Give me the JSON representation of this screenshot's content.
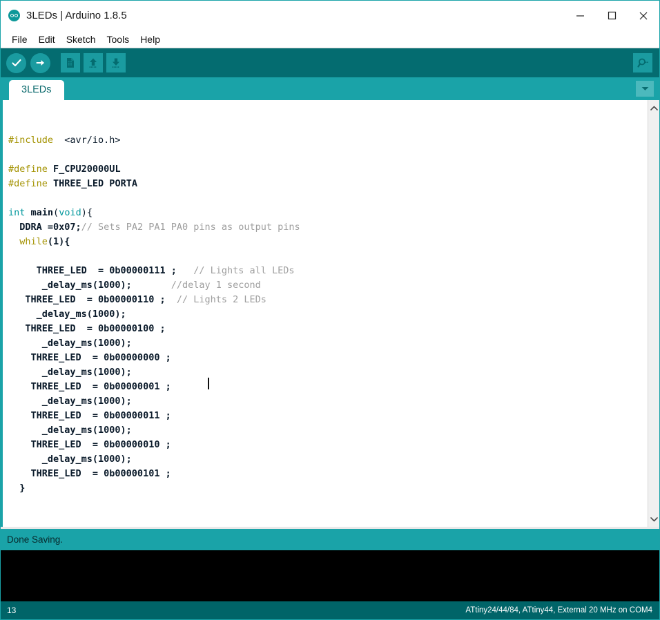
{
  "window": {
    "title": "3LEDs | Arduino 1.8.5",
    "logo_icon": "arduino-logo-icon",
    "controls": [
      {
        "name": "minimize-button",
        "icon": "minimize-icon",
        "label": "—"
      },
      {
        "name": "maximize-button",
        "icon": "maximize-icon",
        "label": "□"
      },
      {
        "name": "close-button",
        "icon": "close-icon",
        "label": "✕"
      }
    ]
  },
  "menubar": {
    "items": [
      {
        "label": "File"
      },
      {
        "label": "Edit"
      },
      {
        "label": "Sketch"
      },
      {
        "label": "Tools"
      },
      {
        "label": "Help"
      }
    ]
  },
  "toolbar": {
    "verify_label": "Verify",
    "upload_label": "Upload",
    "new_label": "New",
    "open_label": "Open",
    "save_label": "Save",
    "serial_monitor_label": "Serial Monitor"
  },
  "tabs": {
    "items": [
      {
        "label": "3LEDs",
        "active": true
      }
    ],
    "menu_icon": "chevron-down-icon"
  },
  "editor": {
    "lines": [
      [
        {
          "t": "#include",
          "c": "k-pre"
        },
        {
          "t": "  <avr/io.h>",
          "c": "k-txt"
        }
      ],
      [],
      [
        {
          "t": "#define",
          "c": "k-pre"
        },
        {
          "t": " F_CPU20000UL",
          "c": "k-fn"
        }
      ],
      [
        {
          "t": "#define",
          "c": "k-pre"
        },
        {
          "t": " THREE_LED PORTA",
          "c": "k-fn"
        }
      ],
      [],
      [
        {
          "t": "int",
          "c": "k-type"
        },
        {
          "t": " ",
          "c": "k-txt"
        },
        {
          "t": "main",
          "c": "k-fn"
        },
        {
          "t": "(",
          "c": "k-txt"
        },
        {
          "t": "void",
          "c": "k-type"
        },
        {
          "t": "){",
          "c": "k-txt"
        }
      ],
      [
        {
          "t": "  ",
          "c": "k-txt"
        },
        {
          "t": "DDRA =0x07;",
          "c": "k-fn"
        },
        {
          "t": "// Sets PA2 PA1 PA0 pins as output pins",
          "c": "k-com"
        }
      ],
      [
        {
          "t": "  ",
          "c": "k-txt"
        },
        {
          "t": "while",
          "c": "k-pre"
        },
        {
          "t": "(1){",
          "c": "k-fn"
        }
      ],
      [],
      [
        {
          "t": "     THREE_LED  = 0b00000111 ;  ",
          "c": "k-fn"
        },
        {
          "t": " // Lights all LEDs",
          "c": "k-com"
        }
      ],
      [
        {
          "t": "      _delay_ms(1000);       ",
          "c": "k-fn"
        },
        {
          "t": "//delay 1 second",
          "c": "k-com"
        }
      ],
      [
        {
          "t": "   THREE_LED  = 0b00000110 ;  ",
          "c": "k-fn"
        },
        {
          "t": "// Lights 2 LEDs",
          "c": "k-com"
        }
      ],
      [
        {
          "t": "     _delay_ms(1000);",
          "c": "k-fn"
        }
      ],
      [
        {
          "t": "   THREE_LED  = 0b00000100 ;",
          "c": "k-fn"
        }
      ],
      [
        {
          "t": "      _delay_ms(1000);",
          "c": "k-fn"
        }
      ],
      [
        {
          "t": "    THREE_LED  = 0b00000000 ;",
          "c": "k-fn"
        }
      ],
      [
        {
          "t": "      _delay_ms(1000);",
          "c": "k-fn"
        }
      ],
      [
        {
          "t": "    THREE_LED  = 0b00000001 ;",
          "c": "k-fn"
        }
      ],
      [
        {
          "t": "      _delay_ms(1000);",
          "c": "k-fn"
        }
      ],
      [
        {
          "t": "    THREE_LED  = 0b00000011 ;",
          "c": "k-fn"
        }
      ],
      [
        {
          "t": "      _delay_ms(1000);",
          "c": "k-fn"
        }
      ],
      [
        {
          "t": "    THREE_LED  = 0b00000010 ;",
          "c": "k-fn"
        }
      ],
      [
        {
          "t": "      _delay_ms(1000);",
          "c": "k-fn"
        }
      ],
      [
        {
          "t": "    THREE_LED  = 0b00000101 ;",
          "c": "k-fn"
        }
      ],
      [
        {
          "t": "  }",
          "c": "k-fn"
        }
      ],
      [],
      [],
      [
        {
          "t": "}",
          "c": "k-fn"
        }
      ]
    ],
    "scroll_up_icon": "chevron-up-icon",
    "scroll_down_icon": "chevron-down-icon"
  },
  "status": {
    "message": "Done Saving."
  },
  "bottom": {
    "line_number": "13",
    "board_info": "ATtiny24/44/84, ATtiny44, External 20 MHz on COM4"
  },
  "colors": {
    "toolbar_dark_teal": "#046c70",
    "tabstrip_teal": "#1aa3a8",
    "icon_tile_teal": "#1a9ba0",
    "status_bar_teal": "#006468",
    "console_black": "#000000",
    "keyword_olive": "#a39200",
    "type_teal": "#00979c",
    "comment_gray": "#9e9e9e"
  }
}
